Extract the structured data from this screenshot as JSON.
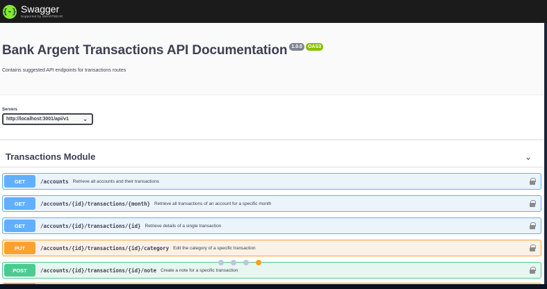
{
  "topbar": {
    "logo_glyph": "{-}",
    "logo_title": "Swagger",
    "logo_sub": "Supported by SMARTBEAR"
  },
  "info": {
    "title": "Bank Argent Transactions API Documentation",
    "version_badge": "1.0.0",
    "oas_badge": "OAS3",
    "description": "Contains suggested API endpoints for transactions routes"
  },
  "servers": {
    "label": "Servers",
    "selected": "http://localhost:3001/api/v1"
  },
  "section": {
    "title": "Transactions Module"
  },
  "operations": [
    {
      "method": "GET",
      "path": "/accounts",
      "summary": "Retrieve all accounts and their transactions"
    },
    {
      "method": "GET",
      "path": "/accounts/{id}/transactions/{month}",
      "summary": "Retrieve all transactions of an account for a specific month"
    },
    {
      "method": "GET",
      "path": "/accounts/{id}/transactions/{id}",
      "summary": "Retrieve details of a single transaction"
    },
    {
      "method": "PUT",
      "path": "/accounts/{id}/transactions/{id}/category",
      "summary": "Edit the category of a specific transaction"
    },
    {
      "method": "POST",
      "path": "/accounts/{id}/transactions/{id}/note",
      "summary": "Create a note for a specific transaction"
    }
  ],
  "colors": {
    "get": "#61affe",
    "put": "#fca130",
    "post": "#49cc90",
    "oas_badge": "#89bf04",
    "version_badge": "#7d8492"
  }
}
